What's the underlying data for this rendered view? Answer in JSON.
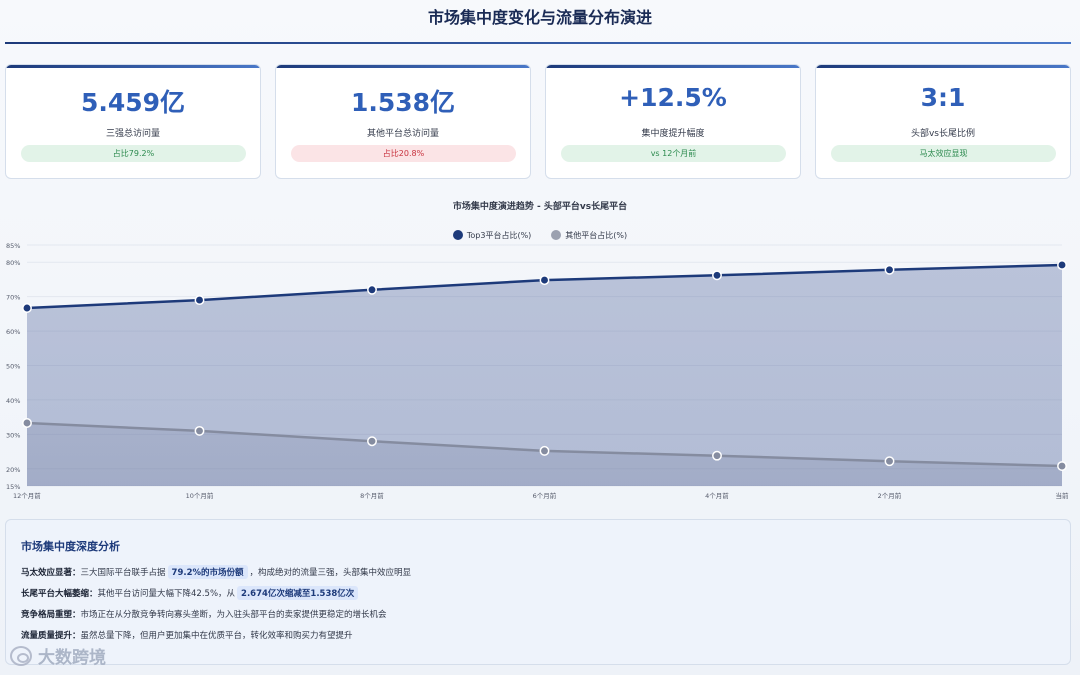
{
  "title": "市场集中度变化与流量分布演进",
  "kpis": [
    {
      "value": "5.459亿",
      "label": "三强总访问量",
      "badge": "占比79.2%",
      "badge_tone": "green"
    },
    {
      "value": "1.538亿",
      "label": "其他平台总访问量",
      "badge": "占比20.8%",
      "badge_tone": "red"
    },
    {
      "value": "+12.5%",
      "label": "集中度提升幅度",
      "badge": "vs 12个月前",
      "badge_tone": "green"
    },
    {
      "value": "3:1",
      "label": "头部vs长尾比例",
      "badge": "马太效应显现",
      "badge_tone": "green"
    }
  ],
  "chart_data": {
    "type": "area",
    "title": "市场集中度演进趋势 - 头部平台vs长尾平台",
    "categories": [
      "12个月前",
      "10个月前",
      "8个月前",
      "6个月前",
      "4个月前",
      "2个月前",
      "当前"
    ],
    "series": [
      {
        "name": "Top3平台占比(%)",
        "values": [
          66.7,
          69.0,
          72.0,
          74.8,
          76.2,
          77.8,
          79.2
        ],
        "color": "#1d3a7a"
      },
      {
        "name": "其他平台占比(%)",
        "values": [
          33.3,
          31.0,
          28.0,
          25.2,
          23.8,
          22.2,
          20.8
        ],
        "color": "#8c93a6"
      }
    ],
    "y_ticks": [
      "15%",
      "20%",
      "30%",
      "40%",
      "50%",
      "60%",
      "70%",
      "80%",
      "85%"
    ],
    "ylim": [
      15,
      85
    ],
    "legend": "top-center",
    "grid": true
  },
  "analysis": {
    "title": "市场集中度深度分析",
    "rows": [
      {
        "label": "马太效应显著：",
        "pre": "三大国际平台联手占据",
        "highlight": "79.2%的市场份额",
        "post": "，构成绝对的流量三强，头部集中效应明显"
      },
      {
        "label": "长尾平台大幅萎缩：",
        "pre": "其他平台访问量大幅下降42.5%，从",
        "highlight": "2.674亿次缩减至1.538亿次",
        "post": ""
      },
      {
        "label": "竞争格局重塑：",
        "pre": "市场正在从分散竞争转向寡头垄断，为入驻头部平台的卖家提供更稳定的增长机会",
        "highlight": "",
        "post": ""
      },
      {
        "label": "流量质量提升：",
        "pre": "虽然总量下降，但用户更加集中在优质平台，转化效率和购买力有望提升",
        "highlight": "",
        "post": ""
      }
    ]
  },
  "watermark": "大数跨境"
}
